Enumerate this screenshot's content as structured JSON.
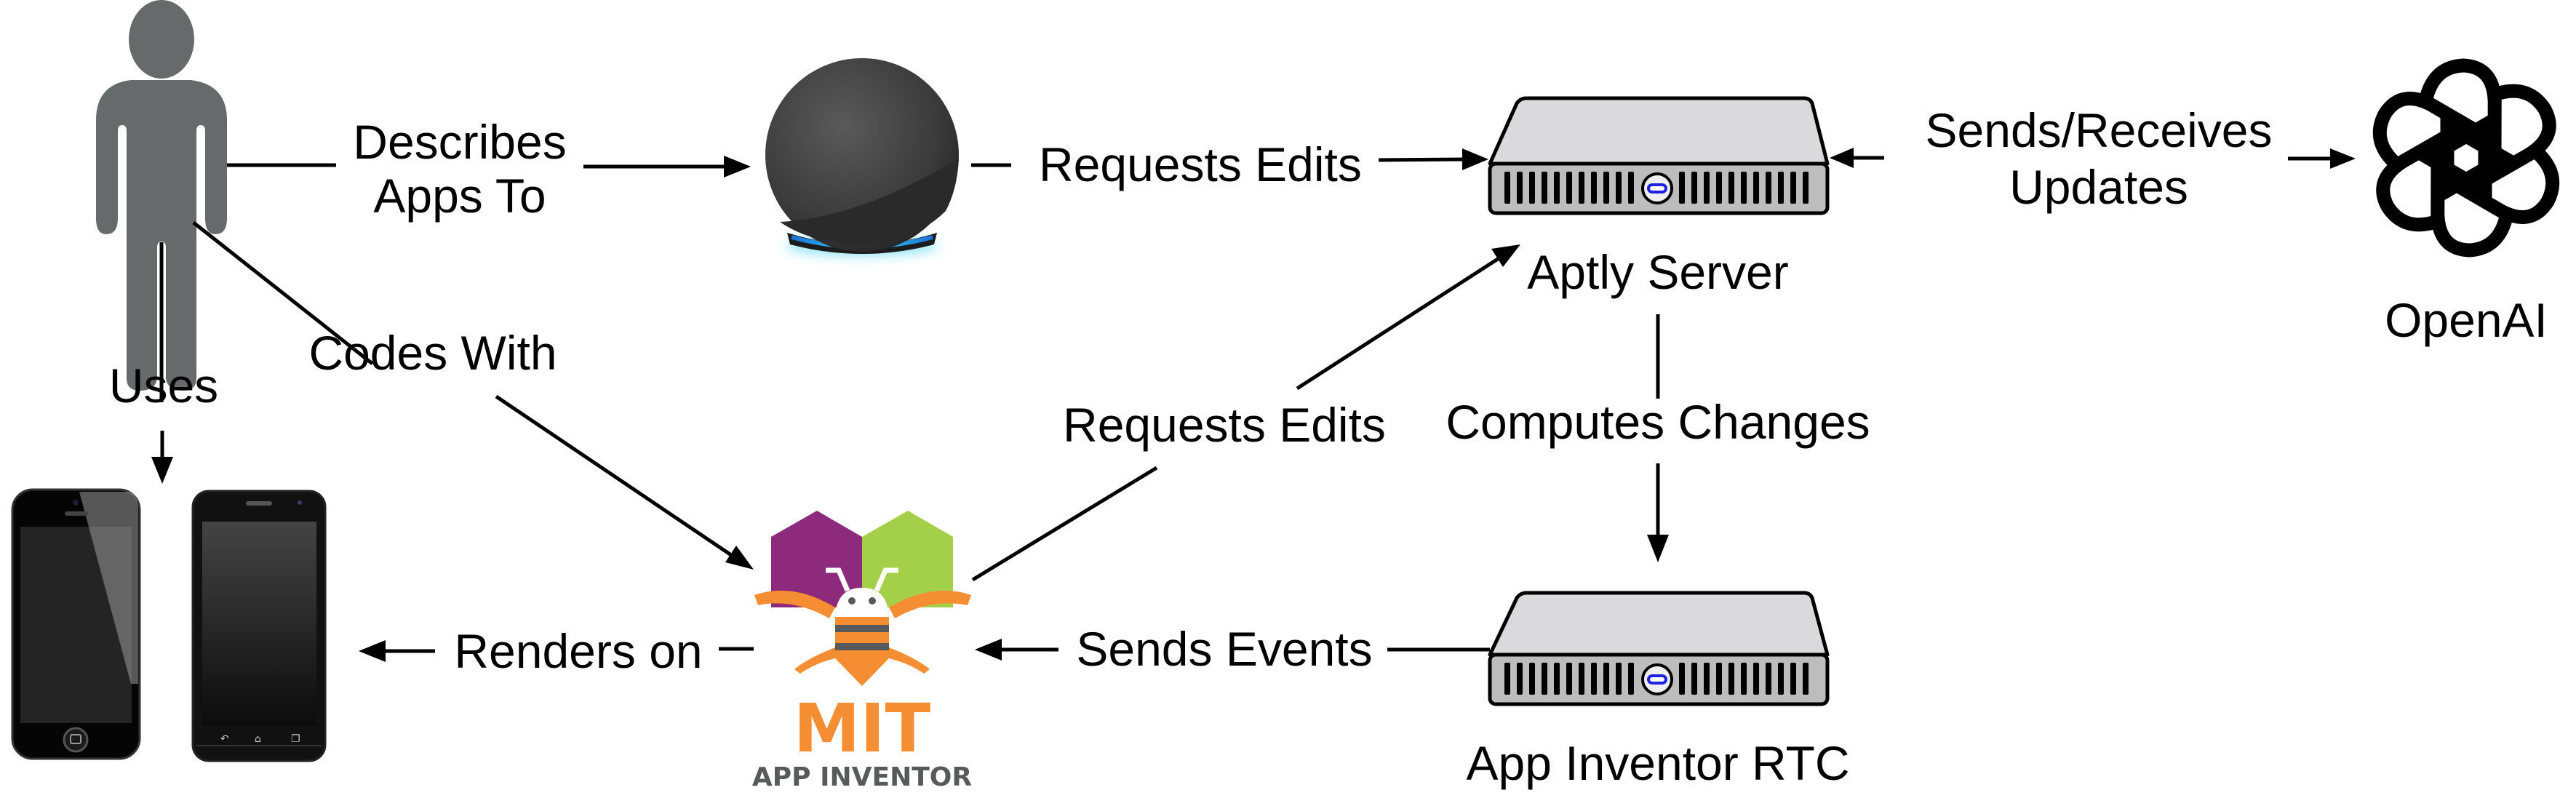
{
  "diagram": {
    "nodes": {
      "user": {
        "label": "",
        "icon": "person-icon",
        "color": "#676A6B"
      },
      "smart_speaker": {
        "label": "",
        "icon": "smart-speaker-icon",
        "accent": "#29C5E6"
      },
      "aptly_server": {
        "label": "Aptly Server",
        "icon": "server-icon"
      },
      "openai": {
        "label": "OpenAI",
        "icon": "openai-logo-icon"
      },
      "phones": {
        "label": "",
        "icon": "smartphone-icon"
      },
      "app_inventor": {
        "label": "",
        "icon": "mit-app-inventor-logo",
        "logo_title": "MIT",
        "logo_subtitle": "APP INVENTOR",
        "colors": {
          "purple": "#8E2A7B",
          "green": "#A4CF48",
          "orange": "#F58D33",
          "gray": "#58595B"
        }
      },
      "rtc_server": {
        "label": "App Inventor RTC",
        "icon": "server-icon"
      }
    },
    "edges": {
      "describes": {
        "line1": "Describes",
        "line2": "Apps To"
      },
      "codes_with": {
        "label": "Codes With"
      },
      "uses": {
        "label": "Uses"
      },
      "speaker_requests": {
        "label": "Requests Edits"
      },
      "ai_requests": {
        "label": "Requests Edits"
      },
      "sends_receives": {
        "line1": "Sends/Receives",
        "line2": "Updates"
      },
      "computes": {
        "label": "Computes Changes"
      },
      "sends_events": {
        "label": "Sends Events"
      },
      "renders_on": {
        "label": "Renders on"
      }
    },
    "server_style": {
      "top_fill": "#DAD9DC",
      "front_fill": "#BDBDBD",
      "led": "#1E22E0"
    }
  }
}
